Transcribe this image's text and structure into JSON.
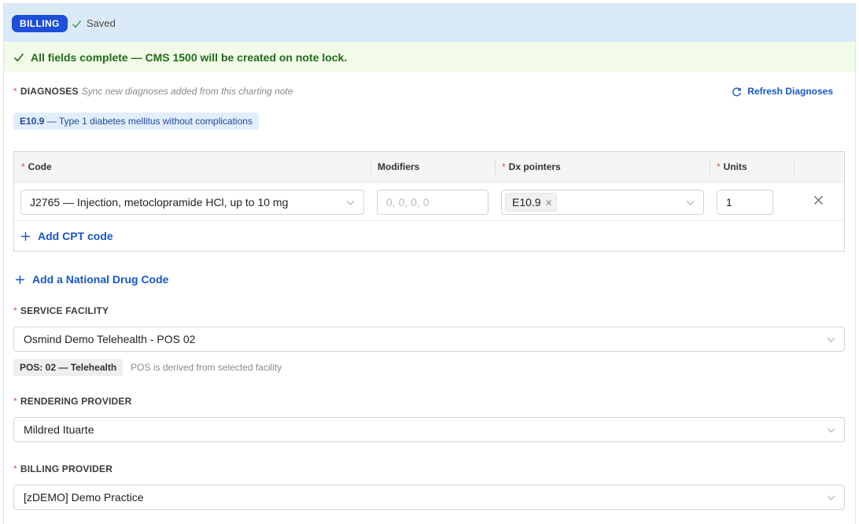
{
  "header": {
    "badge": "BILLING",
    "saved_text": "Saved"
  },
  "alert": {
    "message": "All fields complete — CMS 1500 will be created on note lock."
  },
  "diagnoses": {
    "label": "DIAGNOSES",
    "hint": "Sync new diagnoses added from this charting note",
    "refresh_label": "Refresh Diagnoses",
    "tags": [
      {
        "code": "E10.9",
        "description": "— Type 1 diabetes mellitus without complications"
      }
    ]
  },
  "cpt_table": {
    "columns": {
      "code": "Code",
      "modifiers": "Modifiers",
      "dx_pointers": "Dx pointers",
      "units": "Units"
    },
    "rows": [
      {
        "code": "J2765 — Injection, metoclopramide HCl, up to 10 mg",
        "modifiers_placeholder": "0, 0, 0, 0",
        "dx_pointer": "E10.9",
        "units": "1"
      }
    ],
    "add_label": "Add CPT code"
  },
  "add_ndc_label": "Add a National Drug Code",
  "service_facility": {
    "label": "SERVICE FACILITY",
    "value": "Osmind Demo Telehealth - POS 02",
    "pos_tag": "POS: 02 — Telehealth",
    "pos_note": "POS is derived from selected facility"
  },
  "rendering_provider": {
    "label": "RENDERING PROVIDER",
    "value": "Mildred Ituarte"
  },
  "billing_provider": {
    "label": "BILLING PROVIDER",
    "value": "[zDEMO] Demo Practice"
  },
  "required_marker": "*",
  "colors": {
    "accent": "#1558c9",
    "badge": "#1e4fd8",
    "success_bg": "#f1fbe8",
    "success_text": "#236b1b",
    "header_bg": "#dbeaf8",
    "required": "#e0523a"
  },
  "icons": [
    "check-icon",
    "refresh-icon",
    "chevron-down-icon",
    "close-icon",
    "plus-icon"
  ]
}
